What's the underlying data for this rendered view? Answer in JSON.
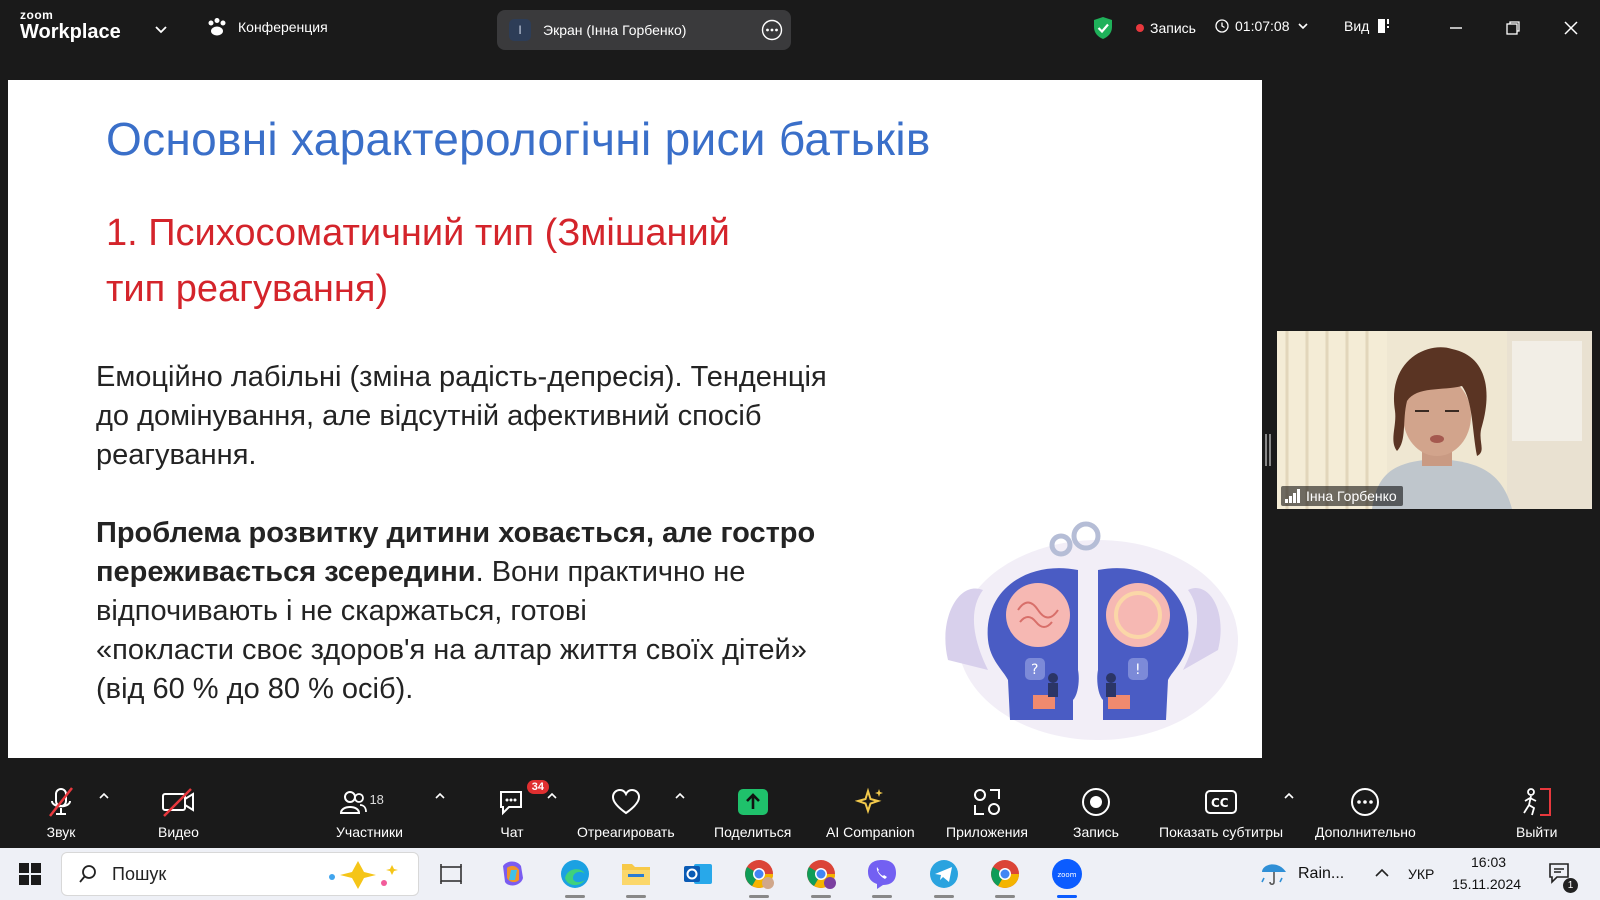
{
  "app": {
    "logo_line1": "zoom",
    "logo_line2": "Workplace",
    "conference_label": "Конференция",
    "screen_initial": "I",
    "screen_label": "Экран (Інна Горбенко)",
    "recording_label": "Запись",
    "timer": "01:07:08",
    "view_label": "Вид"
  },
  "slide": {
    "title": "Основні характерологічні риси батьків",
    "subtitle_line1": "1. Психосоматичний тип (Змішаний",
    "subtitle_line2": "тип  реагування)",
    "p1_line1": "Емоційно лабільні (зміна радість-депресія). Тенденція",
    "p1_line2": "до  домінування, але відсутній афективний спосіб",
    "p1_line3": "реагування.",
    "p2_bold_line1": "Проблема розвитку дитини ховається, але гостро",
    "p2_bold_line2": "переживається  зсередини",
    "p2_rest_line2": ". Вони практично не",
    "p2_line3": "відпочивають і не скаржаться, готові",
    "p2_line4": "«покласти своє здоров'я на алтар життя своїх дітей»",
    "p2_line5": "(від 60 % до 80 % осіб)."
  },
  "participant": {
    "name": "Інна Горбенко"
  },
  "toolbar": {
    "audio": "Звук",
    "video": "Видео",
    "participants": "Участники",
    "participants_count": "18",
    "chat": "Чат",
    "chat_badge": "34",
    "react": "Отреагировать",
    "share": "Поделиться",
    "ai": "AI Companion",
    "apps": "Приложения",
    "record": "Запись",
    "captions": "Показать субтитры",
    "more": "Дополнительно",
    "leave": "Выйти"
  },
  "taskbar": {
    "search_placeholder": "Пошук",
    "weather": "Rain...",
    "lang": "УКР",
    "time": "16:03",
    "date": "15.11.2024",
    "notif_count": "1"
  },
  "colors": {
    "title_blue": "#3a6fc9",
    "subtitle_red": "#d4242b",
    "share_green": "#1fc16b",
    "record_red": "#e8383d",
    "shield_green": "#1fb15a"
  }
}
